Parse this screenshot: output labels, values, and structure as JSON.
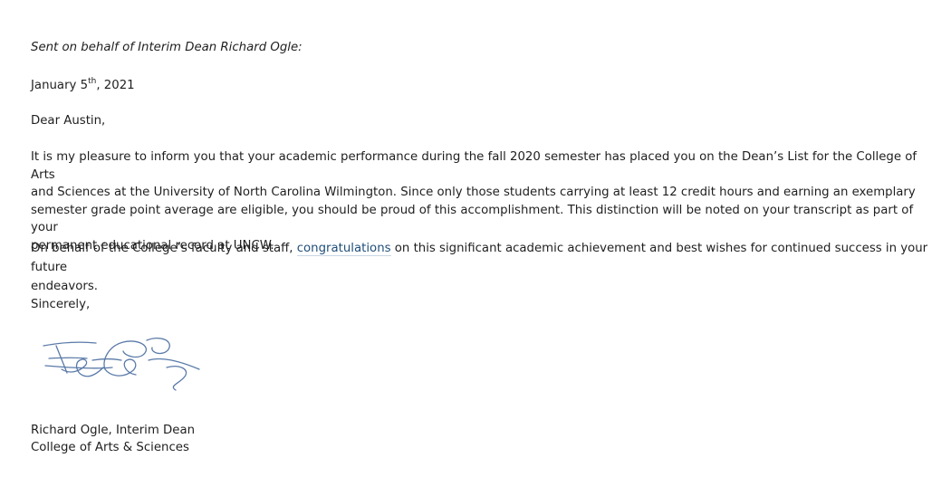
{
  "letter": {
    "sent_on_behalf": "Sent on behalf of Interim Dean Richard Ogle:",
    "date": {
      "month_day": "January 5",
      "ordinal_suffix": "th",
      "year": ", 2021"
    },
    "salutation": "Dear Austin,",
    "paragraph1": {
      "line1": "It is my pleasure to inform you that your academic performance during the fall 2020 semester has placed you on the Dean’s List for the College of Arts",
      "line2": "and Sciences at the University of North Carolina Wilmington. Since only those students carrying at least 12 credit hours and earning an exemplary",
      "line3": "semester grade point average are eligible, you should be proud of this accomplishment. This distinction will be noted on your transcript as part of your",
      "line4": "permanent educational record at UNCW."
    },
    "paragraph2": {
      "before": "On behalf of the College’s faculty and staff,",
      "highlighted": "congratulations",
      "after": "on this significant academic achievement and best wishes for continued success in your future",
      "line2": "endeavors."
    },
    "closing": "Sincerely,",
    "signature_block": {
      "name_title": "Richard Ogle, Interim Dean",
      "college": "College of Arts & Sciences"
    }
  },
  "colors": {
    "text": "#1f1f1f",
    "link": "#1f4e79",
    "signature_ink": "#5a7aa8"
  }
}
